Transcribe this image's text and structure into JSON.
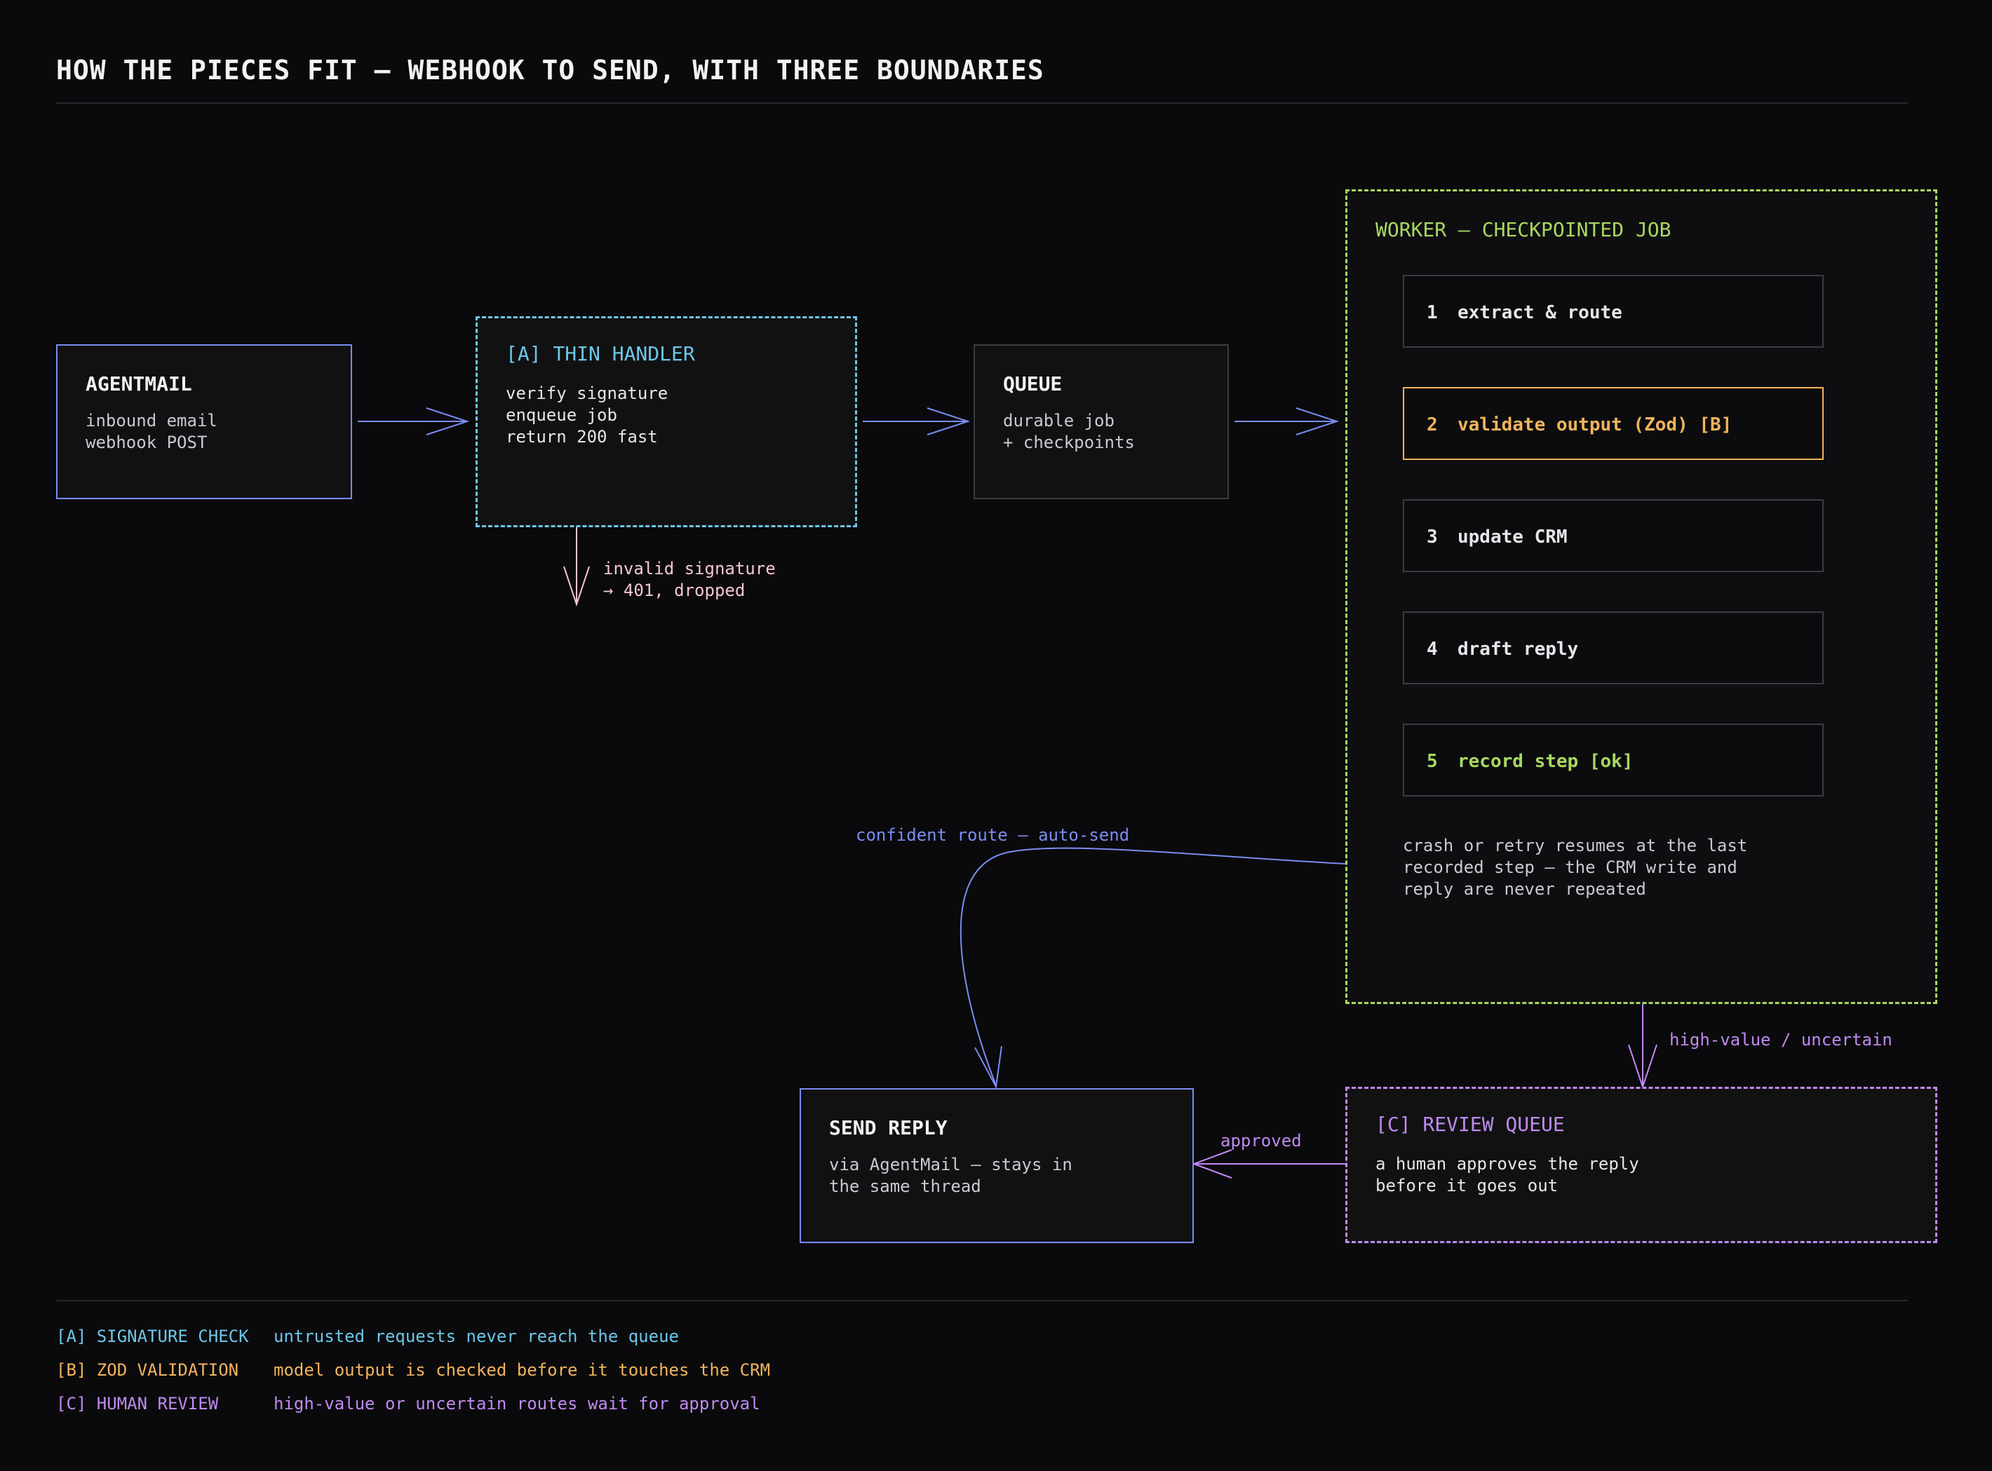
{
  "title": "HOW THE PIECES FIT — WEBHOOK TO SEND, WITH THREE BOUNDARIES",
  "colors": {
    "blue": "#7b8cf0",
    "cyan": "#6ec6e8",
    "orange": "#f0b45c",
    "green": "#a8d860",
    "purple": "#c08af0",
    "pink": "#f5c6d0",
    "neutral": "#4a4a52"
  },
  "nodes": {
    "agentmail": {
      "title": "AGENTMAIL",
      "body": "inbound email\nwebhook POST"
    },
    "handler": {
      "title": "[A] THIN HANDLER",
      "body": "verify signature\nenqueue job\nreturn 200 fast"
    },
    "queue": {
      "title": "QUEUE",
      "body": "durable job\n+ checkpoints"
    },
    "worker": {
      "title": "WORKER — CHECKPOINTED JOB",
      "steps": [
        {
          "num": "1",
          "label": "extract & route"
        },
        {
          "num": "2",
          "label": "validate output (Zod) [B]"
        },
        {
          "num": "3",
          "label": "update CRM"
        },
        {
          "num": "4",
          "label": "draft reply"
        },
        {
          "num": "5",
          "label": "record step [ok]"
        }
      ],
      "note": "crash or retry resumes at the last\nrecorded step — the CRM write and\nreply are never repeated"
    },
    "send_reply": {
      "title": "SEND REPLY",
      "body": "via AgentMail — stays in\nthe same thread"
    },
    "review_queue": {
      "title": "[C] REVIEW QUEUE",
      "body": "a human approves the reply\nbefore it goes out"
    }
  },
  "edge_labels": {
    "invalid": "invalid signature\n→ 401, dropped",
    "confident": "confident route — auto-send",
    "high_value": "high-value / uncertain",
    "approved": "approved"
  },
  "legend": [
    {
      "key": "[A] SIGNATURE CHECK",
      "text": "untrusted requests never reach the queue"
    },
    {
      "key": "[B] ZOD VALIDATION",
      "text": "model output is checked before it touches the CRM"
    },
    {
      "key": "[C] HUMAN REVIEW",
      "text": "high-value or uncertain routes wait for approval"
    }
  ]
}
